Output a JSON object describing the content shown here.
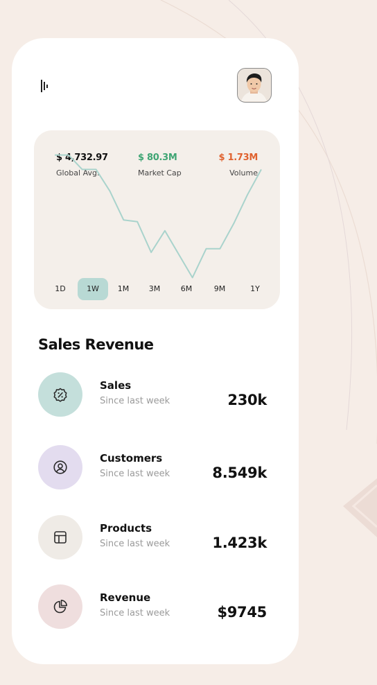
{
  "header": {
    "menu_icon": "menu-bars-icon",
    "avatar_icon": "user-avatar"
  },
  "stats": [
    {
      "value": "$ 4,732.97",
      "label": "Global Avg.",
      "color": "#111111"
    },
    {
      "value": "$ 80.3M",
      "label": "Market Cap",
      "color": "#3fa574"
    },
    {
      "value": "$ 1.73M",
      "label": "Volume",
      "color": "#e0622f"
    }
  ],
  "chart_data": {
    "type": "line",
    "title": "",
    "xlabel": "",
    "ylabel": "",
    "x": [
      0,
      1,
      2,
      3,
      4,
      5,
      6,
      7,
      8,
      9,
      10,
      11,
      12,
      13,
      14,
      15
    ],
    "series": [
      {
        "values": [
          9.4,
          9.4,
          8.6,
          8.6,
          7.4,
          5.8,
          5.7,
          4.0,
          5.2,
          3.9,
          2.6,
          4.2,
          4.2,
          5.6,
          7.2,
          8.6
        ]
      }
    ],
    "ylim": [
      0,
      10
    ],
    "line_color": "#a9d3cc",
    "grid": false
  },
  "time_tabs": [
    "1D",
    "1W",
    "1M",
    "3M",
    "6M",
    "9M",
    "1Y"
  ],
  "active_tab": "1W",
  "section": {
    "title": "Sales Revenue"
  },
  "metrics": [
    {
      "name": "Sales",
      "subtitle": "Since last week",
      "value": "230k",
      "icon": "discount-badge-icon",
      "bg": "#c4dfdb"
    },
    {
      "name": "Customers",
      "subtitle": "Since last week",
      "value": "8.549k",
      "icon": "user-circle-icon",
      "bg": "#e3dcef"
    },
    {
      "name": "Products",
      "subtitle": "Since last week",
      "value": "1.423k",
      "icon": "layout-icon",
      "bg": "#efebe6"
    },
    {
      "name": "Revenue",
      "subtitle": "Since last week",
      "value": "$9745",
      "icon": "pie-chart-icon",
      "bg": "#efdede"
    }
  ],
  "colors": {
    "background": "#f6ede7",
    "card": "#ffffff",
    "panel": "#f4efea",
    "accent": "#b8d9d4"
  }
}
